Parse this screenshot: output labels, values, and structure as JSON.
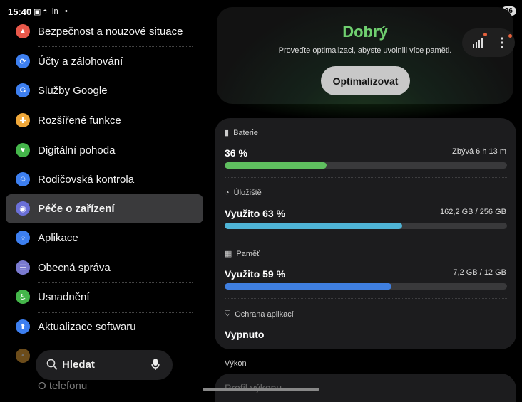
{
  "status_bar": {
    "time": "15:40",
    "battery": "36"
  },
  "sidebar": {
    "items": [
      {
        "label": "Bezpečnost a nouzové situace",
        "icon": "siren-icon",
        "color": "#e8584a"
      },
      {
        "label": "Účty a zálohování",
        "icon": "sync-icon",
        "color": "#3d7ff0"
      },
      {
        "label": "Služby Google",
        "icon": "google-icon",
        "color": "#3d7ff0"
      },
      {
        "label": "Rozšířené funkce",
        "icon": "gear-plus-icon",
        "color": "#f0a83a"
      },
      {
        "label": "Digitální pohoda",
        "icon": "wellbeing-icon",
        "color": "#44b64a"
      },
      {
        "label": "Rodičovská kontrola",
        "icon": "parental-icon",
        "color": "#3d7ff0"
      },
      {
        "label": "Péče o zařízení",
        "icon": "device-care-icon",
        "color": "#6a6fd8"
      },
      {
        "label": "Aplikace",
        "icon": "apps-icon",
        "color": "#3d7ff0"
      },
      {
        "label": "Obecná správa",
        "icon": "sliders-icon",
        "color": "#7a7ad0"
      },
      {
        "label": "Usnadnění",
        "icon": "accessibility-icon",
        "color": "#44b64a"
      },
      {
        "label": "Aktualizace softwaru",
        "icon": "update-icon",
        "color": "#3d7ff0"
      }
    ],
    "partial_bottom_label": "O telefonu"
  },
  "search": {
    "placeholder": "Hledat"
  },
  "device_care": {
    "status_word": "Dobrý",
    "status_color": "#6fcf6f",
    "subtitle": "Proveďte optimalizaci, abyste uvolnili více paměti.",
    "optimize_label": "Optimalizovat"
  },
  "stats": {
    "battery": {
      "title": "Baterie",
      "value": "36 %",
      "right": "Zbývá 6 h 13 m",
      "percent": 36,
      "color": "#5fbf5f"
    },
    "storage": {
      "title": "Úložiště",
      "value": "Využito 63 %",
      "right": "162,2 GB / 256 GB",
      "percent": 63,
      "color": "#4fb4d6"
    },
    "memory": {
      "title": "Paměť",
      "value": "Využito 59 %",
      "right": "7,2 GB / 12 GB",
      "percent": 59,
      "color": "#3f7fe0"
    },
    "app_protection": {
      "title": "Ochrana aplikací",
      "value": "Vypnuto"
    }
  },
  "performance": {
    "section_title": "Výkon",
    "profile_label": "Profil výkonu"
  }
}
